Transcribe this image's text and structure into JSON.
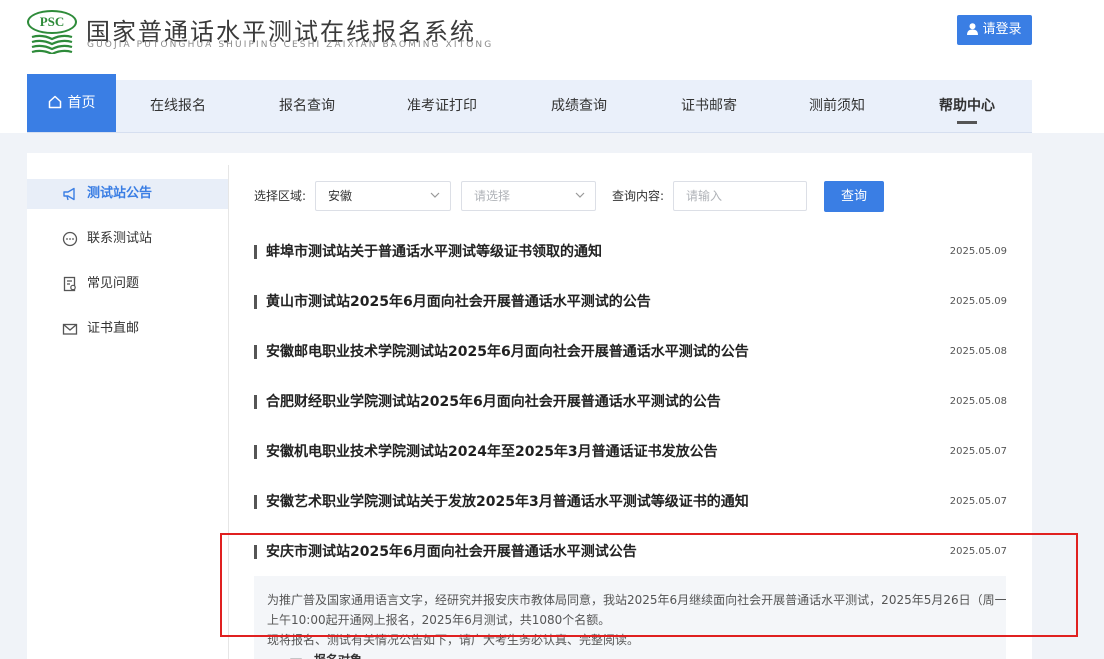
{
  "header": {
    "logo_text": "PSC",
    "title": "国家普通话水平测试在线报名系统",
    "subtitle": "GUOJIA PUTONGHUA SHUIPING CESHI ZAIXIAN BAOMING XITONG",
    "login_label": "请登录"
  },
  "nav": {
    "items": [
      {
        "label": "首页"
      },
      {
        "label": "在线报名"
      },
      {
        "label": "报名查询"
      },
      {
        "label": "准考证打印"
      },
      {
        "label": "成绩查询"
      },
      {
        "label": "证书邮寄"
      },
      {
        "label": "测前须知"
      },
      {
        "label": "帮助中心"
      }
    ]
  },
  "sidebar": {
    "items": [
      {
        "label": "测试站公告",
        "icon": "megaphone-icon"
      },
      {
        "label": "联系测试站",
        "icon": "chat-icon"
      },
      {
        "label": "常见问题",
        "icon": "document-icon"
      },
      {
        "label": "证书直邮",
        "icon": "mail-icon"
      }
    ]
  },
  "filter": {
    "region_label": "选择区域:",
    "region_value": "安徽",
    "city_placeholder": "请选择",
    "content_label": "查询内容:",
    "content_placeholder": "请输入",
    "query_label": "查询"
  },
  "notices": [
    {
      "title": "蚌埠市测试站关于普通话水平测试等级证书领取的通知",
      "date": "2025.05.09"
    },
    {
      "title": "黄山市测试站2025年6月面向社会开展普通话水平测试的公告",
      "date": "2025.05.09"
    },
    {
      "title": "安徽邮电职业技术学院测试站2025年6月面向社会开展普通话水平测试的公告",
      "date": "2025.05.08"
    },
    {
      "title": "合肥财经职业学院测试站2025年6月面向社会开展普通话水平测试的公告",
      "date": "2025.05.08"
    },
    {
      "title": "安徽机电职业技术学院测试站2024年至2025年3月普通话证书发放公告",
      "date": "2025.05.07"
    },
    {
      "title": "安徽艺术职业学院测试站关于发放2025年3月普通话水平测试等级证书的通知",
      "date": "2025.05.07"
    },
    {
      "title": "安庆市测试站2025年6月面向社会开展普通话水平测试公告",
      "date": "2025.05.07"
    }
  ],
  "excerpt": {
    "line1": "为推广普及国家通用语言文字，经研究并报安庆市教体局同意，我站2025年6月继续面向社会开展普通话水平测试，2025年5月26日（周一）",
    "line2": "上午10:00起开通网上报名，2025年6月测试，共1080个名额。",
    "line3": "现将报名、测试有关情况公告如下，请广大考生务必认真、完整阅读。",
    "line4": "一、报名对象"
  },
  "colors": {
    "accent": "#3a7ee4",
    "highlight": "#e02020",
    "logo_green": "#2e8b3a"
  }
}
